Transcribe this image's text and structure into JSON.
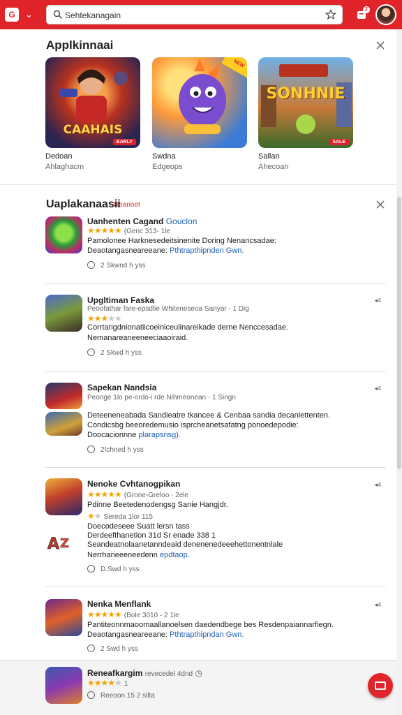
{
  "topbar": {
    "logo_glyph": "G",
    "search_text": "Sehtekanagain",
    "notif_count": "2",
    "accent": "#e0242a"
  },
  "featured": {
    "title": "Applkinnaai",
    "items": [
      {
        "name": "Dedoan",
        "sub": "Ahlaghacm",
        "banner": "CAAHAIS",
        "tag": "EARLY"
      },
      {
        "name": "Swdna",
        "sub": "Edgeops",
        "banner": "",
        "tag": "NEW"
      },
      {
        "name": "Sallan",
        "sub": "Ahecoan",
        "banner": "SONHNIE",
        "tag": "SALE"
      }
    ]
  },
  "updates": {
    "title": "Uaplakanaasii",
    "label": "Reanoet",
    "items": [
      {
        "name": "Uanhenten Cagand",
        "name_link": "Gouclon",
        "meta": "(Genc 313- 1le",
        "line1": "Pamolonee Harknesedeitsinenite Doring Nenancsadae:",
        "line2": "Deaotangasneareeane:",
        "line2_link": "Pthtrapthipnden Gwn.",
        "likes": "2 Skwnd h yss"
      },
      {
        "name": "Upgltiman Faska",
        "meta_a": "Peoofathar fare-epsdlie",
        "meta_b": "Whiteneseoa Sanyar - 1 Dig",
        "line1": "Corrtarigdnionatiicoeiniceulinareikade derne Nenccesadae.",
        "line2": "Nemanareaneeneeciaaoiraid.",
        "likes": "2 Skwd h yss"
      },
      {
        "name": "Sapekan Nandsia",
        "meta": "Peonge 1lo pe-ordo-i rde Nihmeonean · 1 Singn",
        "line1": "Deteeneneabada Sandieatre tkancee & Cenbaa sandia decanlettenten.",
        "line2": "Condicsbg beeoredemusio isprcheanetsafatng ponoedepodie:",
        "line3": "Doocacionnne",
        "line3_link": "plarapsnsg).",
        "likes": "2Ichned h yss"
      },
      {
        "name": "Nenoke Cvhtanogpikan",
        "meta": "(Grone-Greloo · 2ele",
        "line1": "Pdinne Beetedenodengsg Sanie Hangjdr.",
        "meta2": "Sereda 1lor 115",
        "line2": "Doecodeseee Suatt lersn tass",
        "line3": "Derdeefthanetion 31d Sr enade 338 1",
        "line4": "Seandeatnolaanetanndeaid denenenedeeehettonentnlale",
        "line5": "Nerrhaneeeneedenn",
        "line5_link": "epdtaop.",
        "likes": "D.Swd h yss"
      },
      {
        "name": "Nenka Menflank",
        "meta": "(Bole 3010 - 2 1le",
        "line1": "Pantiteonnmaoomaallanoelsen daedendbege bes Resdenpaiannarfiegn.",
        "line2": "Deaotangasneareeane:",
        "line2_link": "Pthtrapthipndan Gwn.",
        "likes": "2 Swd h yss"
      }
    ]
  },
  "bottom": {
    "name": "Reneafkargim",
    "meta": "revecedel 4dnd",
    "rating_num": "1",
    "sub": "Reeoon 15 2 silta"
  }
}
